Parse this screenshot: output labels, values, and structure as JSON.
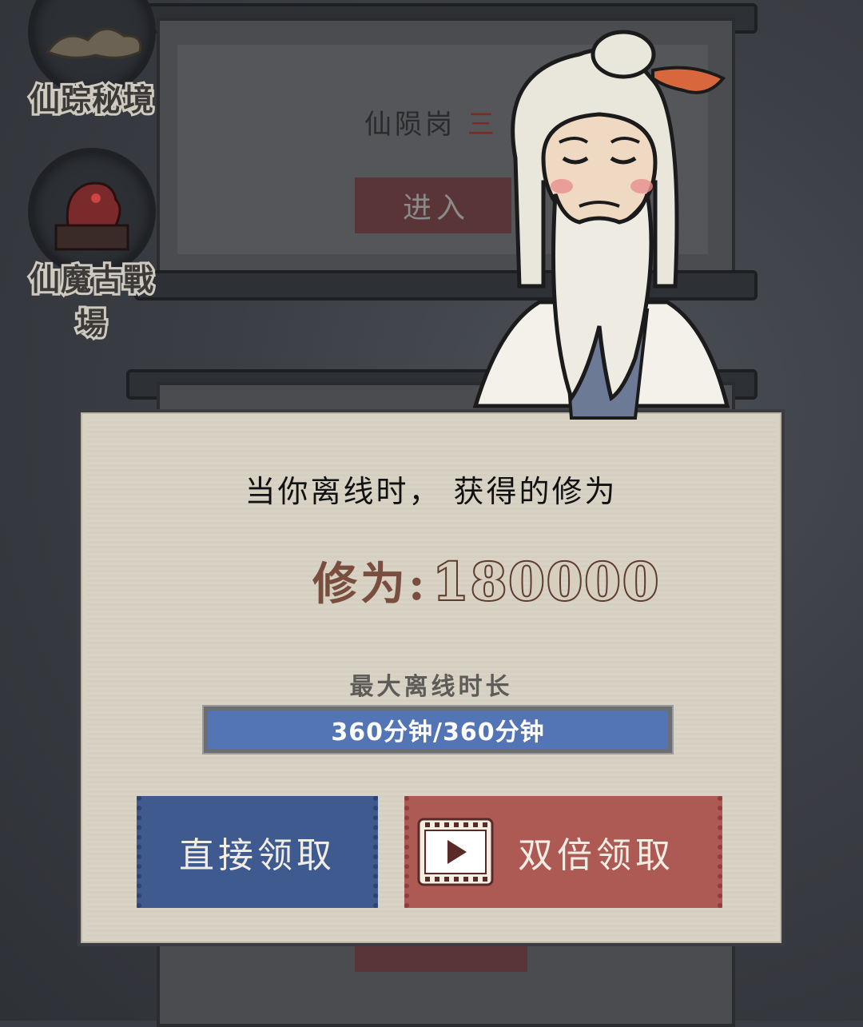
{
  "side_menu": [
    {
      "label_line1": "仙踪秘境",
      "label_line2": "",
      "icon": "cloud-icon"
    },
    {
      "label_line1": "仙魔古戰場",
      "label_line2": "",
      "icon": "dragon-statue-icon"
    }
  ],
  "background_scroll": {
    "title": "仙陨岗",
    "title_suffix": "三",
    "enter_label": "进入"
  },
  "dialog": {
    "heading": "当你离线时， 获得的修为",
    "reward_label": "修为:",
    "reward_value": "180000",
    "max_offline_label": "最大离线时长",
    "progress": {
      "text": "360分钟/360分钟",
      "fraction": 1.0
    },
    "claim_button": "直接领取",
    "double_button": "双倍领取"
  },
  "colors": {
    "claim_button": "#3f5a8e",
    "double_button": "#ad5a55",
    "progress_bar": "#4e6fae",
    "dialog_bg": "#d8d2c4"
  }
}
